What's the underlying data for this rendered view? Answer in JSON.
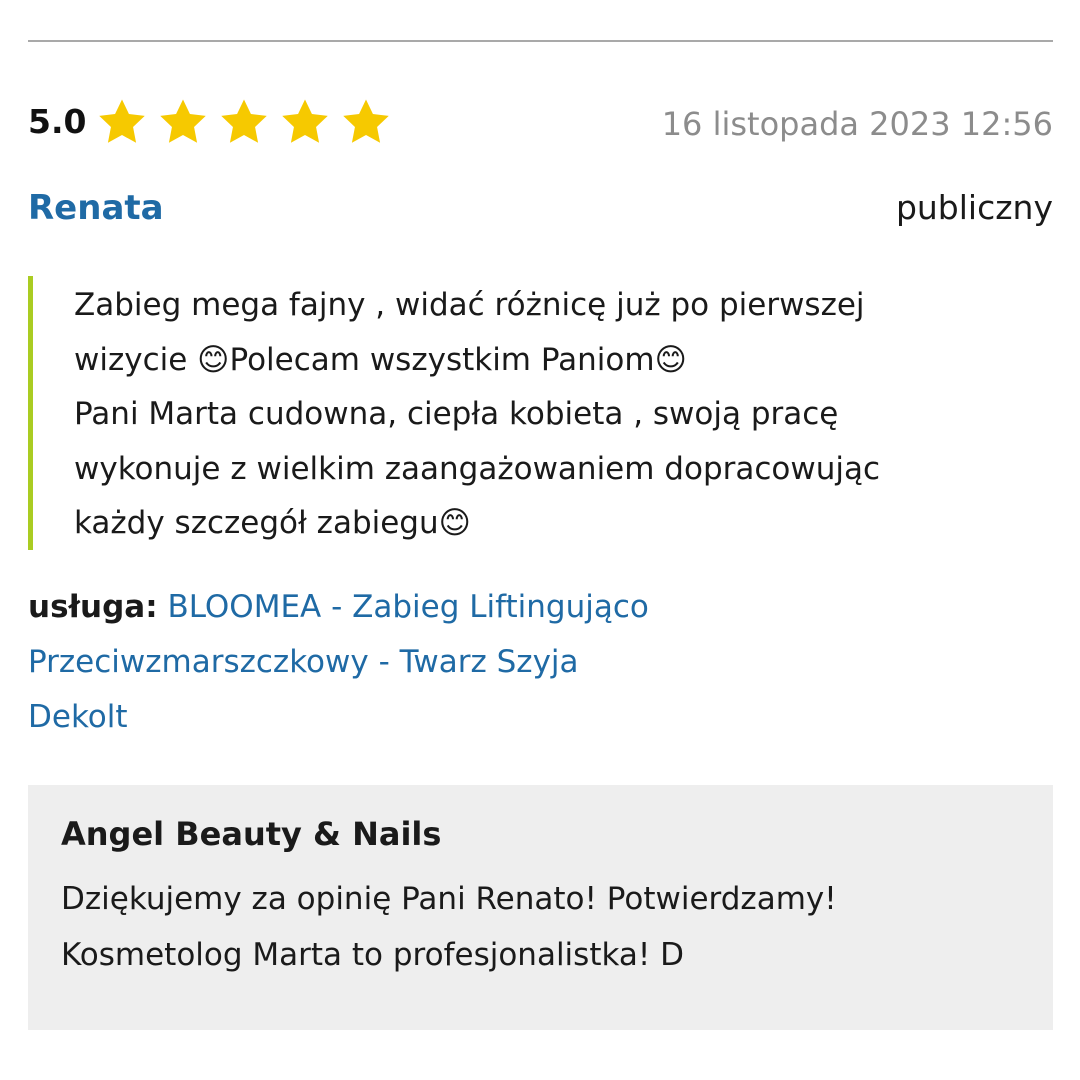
{
  "review": {
    "score": "5.0",
    "rating": 5,
    "max_rating": 5,
    "star_color": "#f6c900",
    "date": "16 listopada 2023 12:56",
    "author": "Renata",
    "visibility": "publiczny",
    "text": "Zabieg mega fajny , widać różnicę już po pierwszej\nwizycie 😊Polecam wszystkim Paniom😊\nPani Marta cudowna, ciepła kobieta , swoją pracę\nwykonuje z wielkim zaangażowaniem dopracowując\nkażdy szczegół zabiegu😊",
    "service_label": "usługa:",
    "service_name": "BLOOMEA - Zabieg Liftingująco Przeciwzmarszczkowy - Twarz Szyja Dekolt"
  },
  "reply": {
    "author": "Angel Beauty & Nails",
    "text": "Dziękujemy za opinię Pani Renato! Potwierdzamy! Kosmetolog Marta to profesjonalistka! D"
  },
  "colors": {
    "accent_link": "#1f6aa5",
    "quote_border": "#aacc22",
    "reply_background": "#eeeeee"
  }
}
